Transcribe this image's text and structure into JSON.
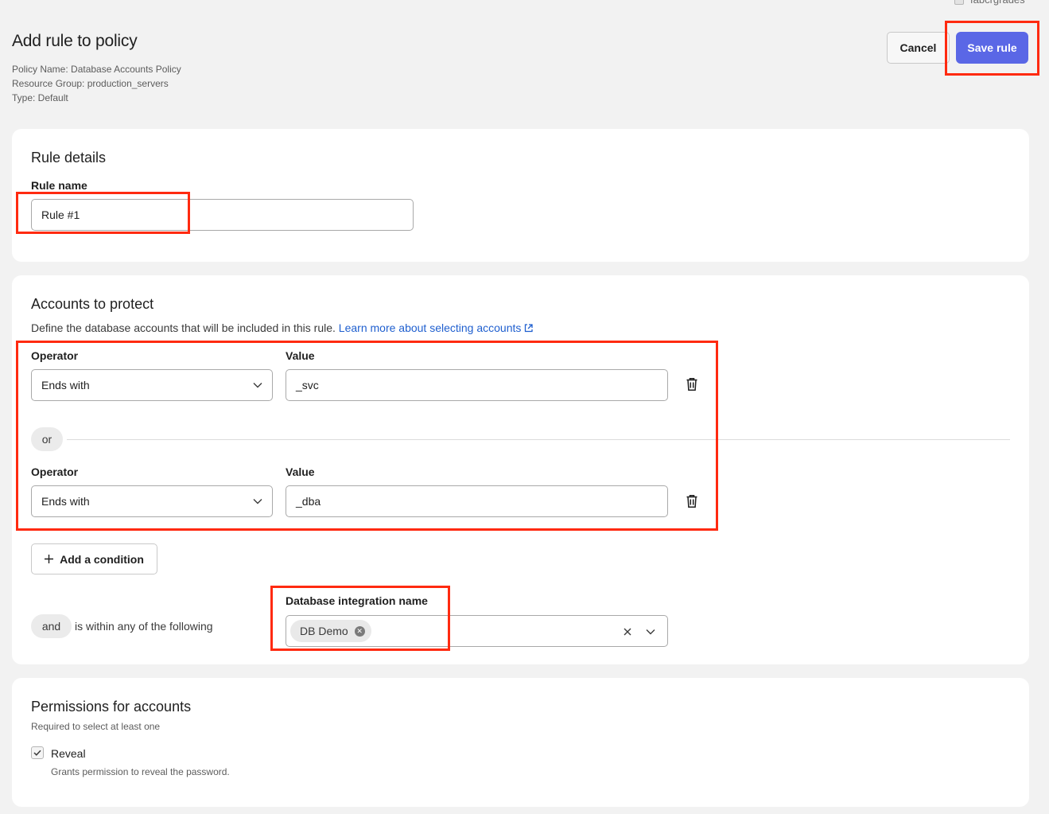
{
  "top_clip": {
    "label": "fabcrgrades"
  },
  "header": {
    "title": "Add rule to policy",
    "meta": [
      "Policy Name: Database Accounts Policy",
      "Resource Group: production_servers",
      "Type: Default"
    ],
    "cancel_label": "Cancel",
    "save_label": "Save rule"
  },
  "rule_details": {
    "title": "Rule details",
    "name_label": "Rule name",
    "name_value": "Rule #1"
  },
  "accounts": {
    "title": "Accounts to protect",
    "description": "Define the database accounts that will be included in this rule.",
    "learn_more": "Learn more about selecting accounts",
    "conditions": [
      {
        "operator_label": "Operator",
        "operator": "Ends with",
        "value_label": "Value",
        "value": "_svc"
      },
      {
        "operator_label": "Operator",
        "operator": "Ends with",
        "value_label": "Value",
        "value": "_dba"
      }
    ],
    "or_label": "or",
    "add_condition": "Add a condition",
    "and_label": "and",
    "within_text": "is within any of the following",
    "integration_label": "Database integration name",
    "integration_chip": "DB Demo"
  },
  "permissions": {
    "title": "Permissions for accounts",
    "subtitle": "Required to select at least one",
    "reveal_label": "Reveal",
    "reveal_checked": true,
    "reveal_desc": "Grants permission to reveal the password."
  },
  "colors": {
    "primary": "#5a67e6",
    "highlight": "#ff2a10",
    "link": "#1f5fcf"
  }
}
